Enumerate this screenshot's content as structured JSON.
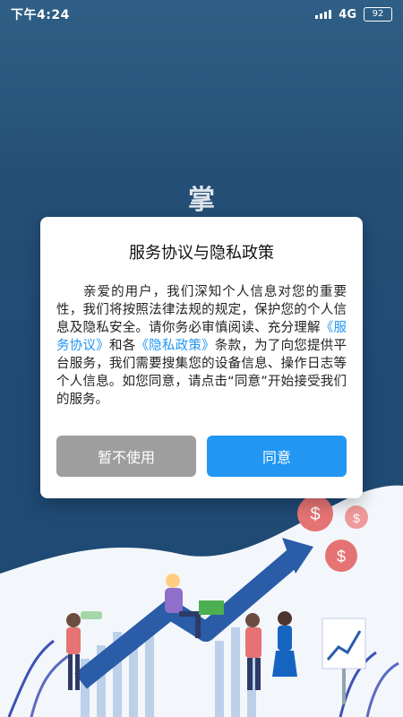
{
  "status": {
    "time": "下午4:24",
    "network": "4G",
    "battery": "92"
  },
  "background": {
    "logo_text": "掌"
  },
  "dialog": {
    "title": "服务协议与隐私政策",
    "body_part1": "亲爱的用户，我们深知个人信息对您的重要性，我们将按照法律法规的规定，保护您的个人信息及隐私安全。请你务必审慎阅读、充分理解",
    "link_service": "《服务协议》",
    "body_part2": "和各",
    "link_privacy": "《隐私政策》",
    "body_part3": "条款，为了向您提供平台服务，我们需要搜集您的设备信息、操作日志等个人信息。如您同意，请点击“同意”开始接受我们的服务。",
    "cancel_label": "暂不使用",
    "agree_label": "同意"
  },
  "colors": {
    "accent": "#2196f3",
    "cancel": "#9e9e9e",
    "background": "#1f4a74"
  },
  "illustration": {
    "coin_symbol": "$"
  }
}
